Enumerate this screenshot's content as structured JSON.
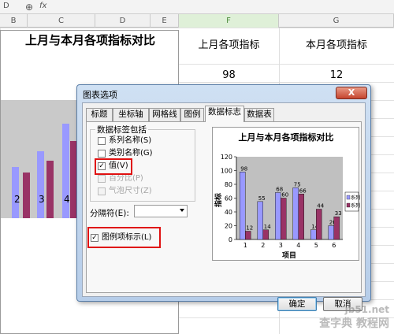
{
  "formula_bar": {
    "name_box": "D",
    "zoom_symbol": "⊕",
    "fx_label": "fx"
  },
  "columns": [
    "B",
    "C",
    "D",
    "E",
    "F",
    "G"
  ],
  "header_cells": {
    "f": "上月各项指标",
    "g": "本月各项指标"
  },
  "row_cells": {
    "f": "98",
    "g": "12"
  },
  "bg_chart": {
    "title": "上月与本月各项指标对比",
    "x_ticks": [
      "2",
      "3",
      "4"
    ]
  },
  "dialog": {
    "title": "图表选项",
    "close_label": "X",
    "tabs": [
      "标题",
      "坐标轴",
      "网格线",
      "图例",
      "数据标志",
      "数据表"
    ],
    "active_tab": "数据标志",
    "group_label": "数据标签包括",
    "options": [
      {
        "label": "系列名称(S)",
        "checked": false,
        "disabled": false
      },
      {
        "label": "类别名称(G)",
        "checked": false,
        "disabled": false
      },
      {
        "label": "值(V)",
        "checked": true,
        "disabled": false
      },
      {
        "label": "百分比(P)",
        "checked": false,
        "disabled": true
      },
      {
        "label": "气泡尺寸(Z)",
        "checked": false,
        "disabled": true
      }
    ],
    "separator_label": "分隔符(E):",
    "separator_value": "",
    "legend_key_label": "图例项标示(L)",
    "legend_key_checked": true,
    "ok_label": "确定",
    "cancel_label": "取消"
  },
  "chart_data": {
    "type": "bar",
    "title": "上月与本月各项指标对比",
    "categories": [
      "1",
      "2",
      "3",
      "4",
      "5",
      "6"
    ],
    "series": [
      {
        "name": "系列1",
        "values": [
          98,
          55,
          68,
          75,
          14,
          20
        ]
      },
      {
        "name": "系列2",
        "values": [
          12,
          14,
          60,
          66,
          44,
          33
        ]
      }
    ],
    "xlabel": "项目",
    "ylabel": "指标",
    "ylim": [
      0,
      120
    ],
    "yticks": [
      0,
      20,
      40,
      60,
      80,
      100,
      120
    ],
    "legend": "right",
    "colors": [
      "#9999ff",
      "#993366"
    ]
  },
  "watermark": {
    "line1": "jb51.net",
    "line2": "查字典 教程网"
  }
}
